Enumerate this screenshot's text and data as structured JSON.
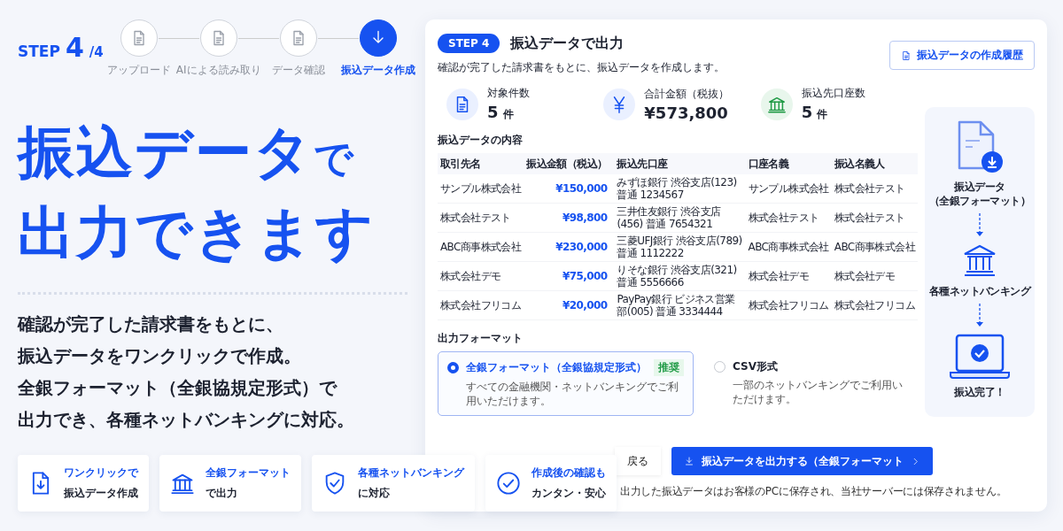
{
  "progress": {
    "prefix": "STEP",
    "current": "4",
    "total": "/4",
    "steps": [
      {
        "label": "アップロード",
        "selected": false
      },
      {
        "label": "AIによる読み取り",
        "selected": false
      },
      {
        "label": "データ確認",
        "selected": false
      },
      {
        "label": "振込データ作成",
        "selected": true
      }
    ]
  },
  "hero": {
    "title_lines": [
      [
        {
          "text": "振込データ",
          "small": false
        },
        {
          "text": "で",
          "small": true
        }
      ],
      [
        {
          "text": "出力できます",
          "small": false
        }
      ]
    ],
    "description": [
      "確認が完了した請求書をもとに、",
      "振込データをワンクリックで作成。",
      "全銀フォーマット（全銀協規定形式）で",
      "出力でき、各種ネットバンキングに対応。"
    ]
  },
  "features": [
    {
      "kind": "file-download",
      "line1": "ワンクリックで",
      "line2": "振込データ作成"
    },
    {
      "kind": "bank",
      "line1": "全銀フォーマット",
      "line2": "で出力"
    },
    {
      "kind": "shield",
      "line1": "各種ネットバンキング",
      "line2": "に対応"
    },
    {
      "kind": "check",
      "line1": "作成後の確認も",
      "line2": "カンタン・安心"
    }
  ],
  "panel": {
    "badge": "STEP 4",
    "title": "振込データで出力",
    "subtitle": "確認が完了した請求書をもとに、振込データを作成します。",
    "history_button": "振込データの作成履歴",
    "stats": [
      {
        "kind": "document",
        "label": "対象件数",
        "value": "5",
        "unit": "件"
      },
      {
        "kind": "yen",
        "label": "合計金額（税抜）",
        "value": "¥573,800"
      },
      {
        "kind": "bank",
        "label": "振込先口座数",
        "value": "5",
        "unit": "件"
      }
    ],
    "table": {
      "title": "振込データの内容",
      "columns": [
        "取引先名",
        "振込金額（税込）",
        "振込先口座",
        "口座名義",
        "振込名義人"
      ],
      "rows": [
        [
          "サンプル株式会社",
          "¥150,000",
          "みずほ銀行 渋谷支店(123) 普通 1234567",
          "サンプル株式会社",
          "株式会社テスト"
        ],
        [
          "株式会社テスト",
          "¥98,800",
          "三井住友銀行 渋谷支店(456) 普通 7654321",
          "株式会社テスト",
          "株式会社テスト"
        ],
        [
          "ABC商事株式会社",
          "¥230,000",
          "三菱UFJ銀行 渋谷支店(789) 普通 1112222",
          "ABC商事株式会社",
          "ABC商事株式会社"
        ],
        [
          "株式会社デモ",
          "¥75,000",
          "りそな銀行 渋谷支店(321) 普通 5556666",
          "株式会社デモ",
          "株式会社デモ"
        ],
        [
          "株式会社フリコム",
          "¥20,000",
          "PayPay銀行 ビジネス営業部(005) 普通 3334444",
          "株式会社フリコム",
          "株式会社フリコム"
        ]
      ]
    },
    "format": {
      "title": "出力フォーマット",
      "options": [
        {
          "label": "全銀フォーマット（全銀協規定形式）",
          "badge": "推奨",
          "description": "すべての金融機関・ネットバンキングでご利用いただけます。",
          "selected": true
        },
        {
          "label": "CSV形式",
          "description": "一部のネットバンキングでご利用いただけます。",
          "selected": false
        }
      ]
    },
    "flow": [
      {
        "kind": "file",
        "lines": [
          "振込データ",
          "（全銀フォーマット）"
        ]
      },
      {
        "kind": "bank",
        "lines": [
          "各種ネットバンキング"
        ]
      },
      {
        "kind": "laptop",
        "lines": [
          "振込完了！"
        ]
      }
    ],
    "back_button": "戻る",
    "primary_button": "振込データを出力する（全銀フォーマット",
    "note": "出力した振込データはお客様のPCに保存され、当社サーバーには保存されません。"
  }
}
